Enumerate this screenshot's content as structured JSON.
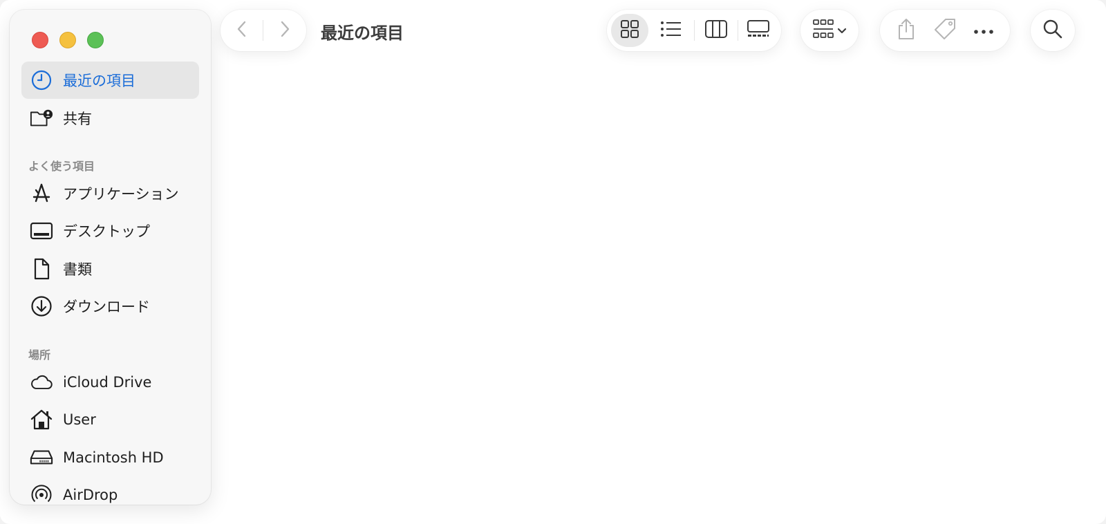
{
  "window": {
    "title": "最近の項目"
  },
  "sidebar": {
    "items_top": [
      {
        "label": "最近の項目",
        "icon": "clock-icon",
        "selected": true
      },
      {
        "label": "共有",
        "icon": "shared-folder-icon",
        "selected": false
      }
    ],
    "section_favorites": "よく使う項目",
    "favorites": [
      {
        "label": "アプリケーション",
        "icon": "applications-icon"
      },
      {
        "label": "デスクトップ",
        "icon": "desktop-icon"
      },
      {
        "label": "書類",
        "icon": "document-icon"
      },
      {
        "label": "ダウンロード",
        "icon": "download-icon"
      }
    ],
    "section_locations": "場所",
    "locations": [
      {
        "label": "iCloud Drive",
        "icon": "cloud-icon"
      },
      {
        "label": "User",
        "icon": "home-icon"
      },
      {
        "label": "Macintosh HD",
        "icon": "hard-drive-icon"
      },
      {
        "label": "AirDrop",
        "icon": "airdrop-icon"
      }
    ]
  },
  "toolbar": {
    "view_modes": [
      "icon-view",
      "list-view",
      "column-view",
      "gallery-view"
    ],
    "selected_view": "icon-view"
  },
  "colors": {
    "accent": "#1a6cd8",
    "close": "#ee5b53",
    "minimize": "#f5c13f",
    "zoom": "#5cc157"
  }
}
